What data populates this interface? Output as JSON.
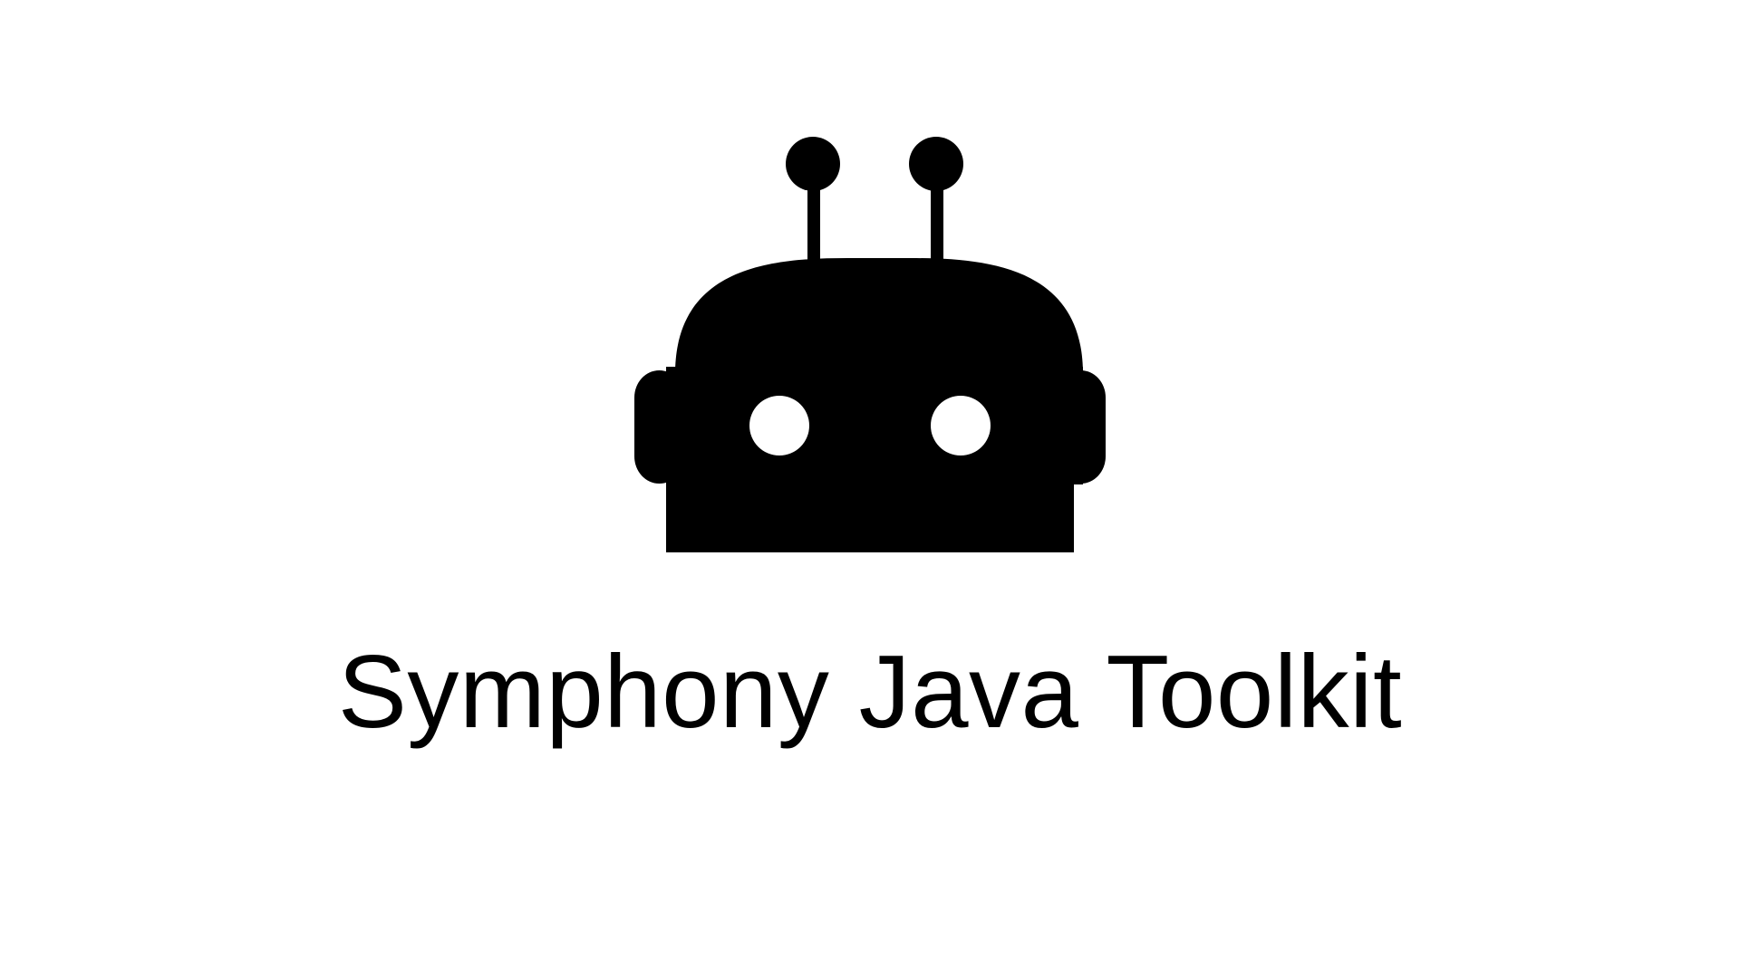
{
  "title": "Symphony Java Toolkit",
  "logo": {
    "icon": "robot-head-icon",
    "color": "#000000",
    "eye_color": "#ffffff"
  },
  "background": "#ffffff"
}
